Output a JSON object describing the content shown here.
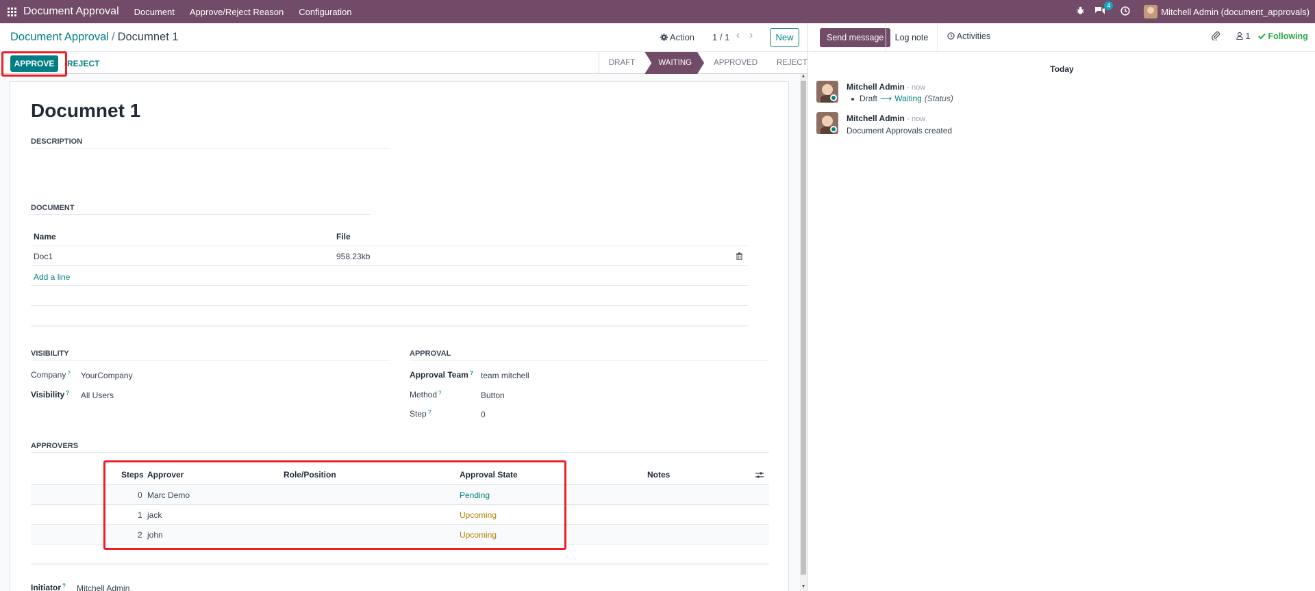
{
  "navbar": {
    "brand": "Document Approval",
    "menu": [
      "Document",
      "Approve/Reject Reason",
      "Configuration"
    ],
    "chat_badge": "4",
    "user_name": "Mitchell Admin (document_approvals)"
  },
  "control": {
    "breadcrumb_parent": "Document Approval",
    "breadcrumb_sep": "/",
    "breadcrumb_current": "Documnet 1",
    "action_label": "Action",
    "pager": "1 / 1",
    "new_label": "New"
  },
  "status": {
    "approve_label": "APPROVE",
    "reject_label": "REJECT",
    "stages": [
      "DRAFT",
      "WAITING",
      "APPROVED",
      "REJECTED"
    ],
    "active_stage": "WAITING"
  },
  "form": {
    "title": "Documnet 1",
    "description_title": "DESCRIPTION",
    "document_title": "DOCUMENT",
    "doc_headers": [
      "Name",
      "File"
    ],
    "doc_rows": [
      {
        "name": "Doc1",
        "file": "958.23kb"
      }
    ],
    "add_line": "Add a line",
    "visibility_title": "VISIBILITY",
    "company_label": "Company",
    "company_value": "YourCompany",
    "visibility_label": "Visibility",
    "visibility_value": "All Users",
    "approval_title": "APPROVAL",
    "team_label": "Approval Team",
    "team_value": "team mitchell",
    "method_label": "Method",
    "method_value": "Button",
    "step_label": "Step",
    "step_value": "0",
    "approvers_title": "APPROVERS",
    "approver_headers": [
      "Steps",
      "Approver",
      "Role/Position",
      "Approval State",
      "Notes"
    ],
    "approver_rows": [
      {
        "step": "0",
        "approver": "Marc Demo",
        "state": "Pending"
      },
      {
        "step": "1",
        "approver": "jack",
        "state": "Upcoming"
      },
      {
        "step": "2",
        "approver": "john",
        "state": "Upcoming"
      }
    ],
    "initiator_label": "Initiator",
    "initiator_value": "Mitchell Admin",
    "help_mark": "?"
  },
  "chatter": {
    "send_message": "Send message",
    "log_note": "Log note",
    "activities": "Activities",
    "followers_count": "1",
    "following": "Following",
    "today": "Today",
    "messages": [
      {
        "author": "Mitchell Admin",
        "time": "now",
        "old": "Draft",
        "new": "Waiting",
        "field": "(Status)"
      },
      {
        "author": "Mitchell Admin",
        "time": "now",
        "body": "Document Approvals created"
      }
    ]
  },
  "colors": {
    "brand": "#714b67",
    "accent": "#017e84",
    "highlight": "#ee1c25",
    "upcoming": "#b58105"
  }
}
